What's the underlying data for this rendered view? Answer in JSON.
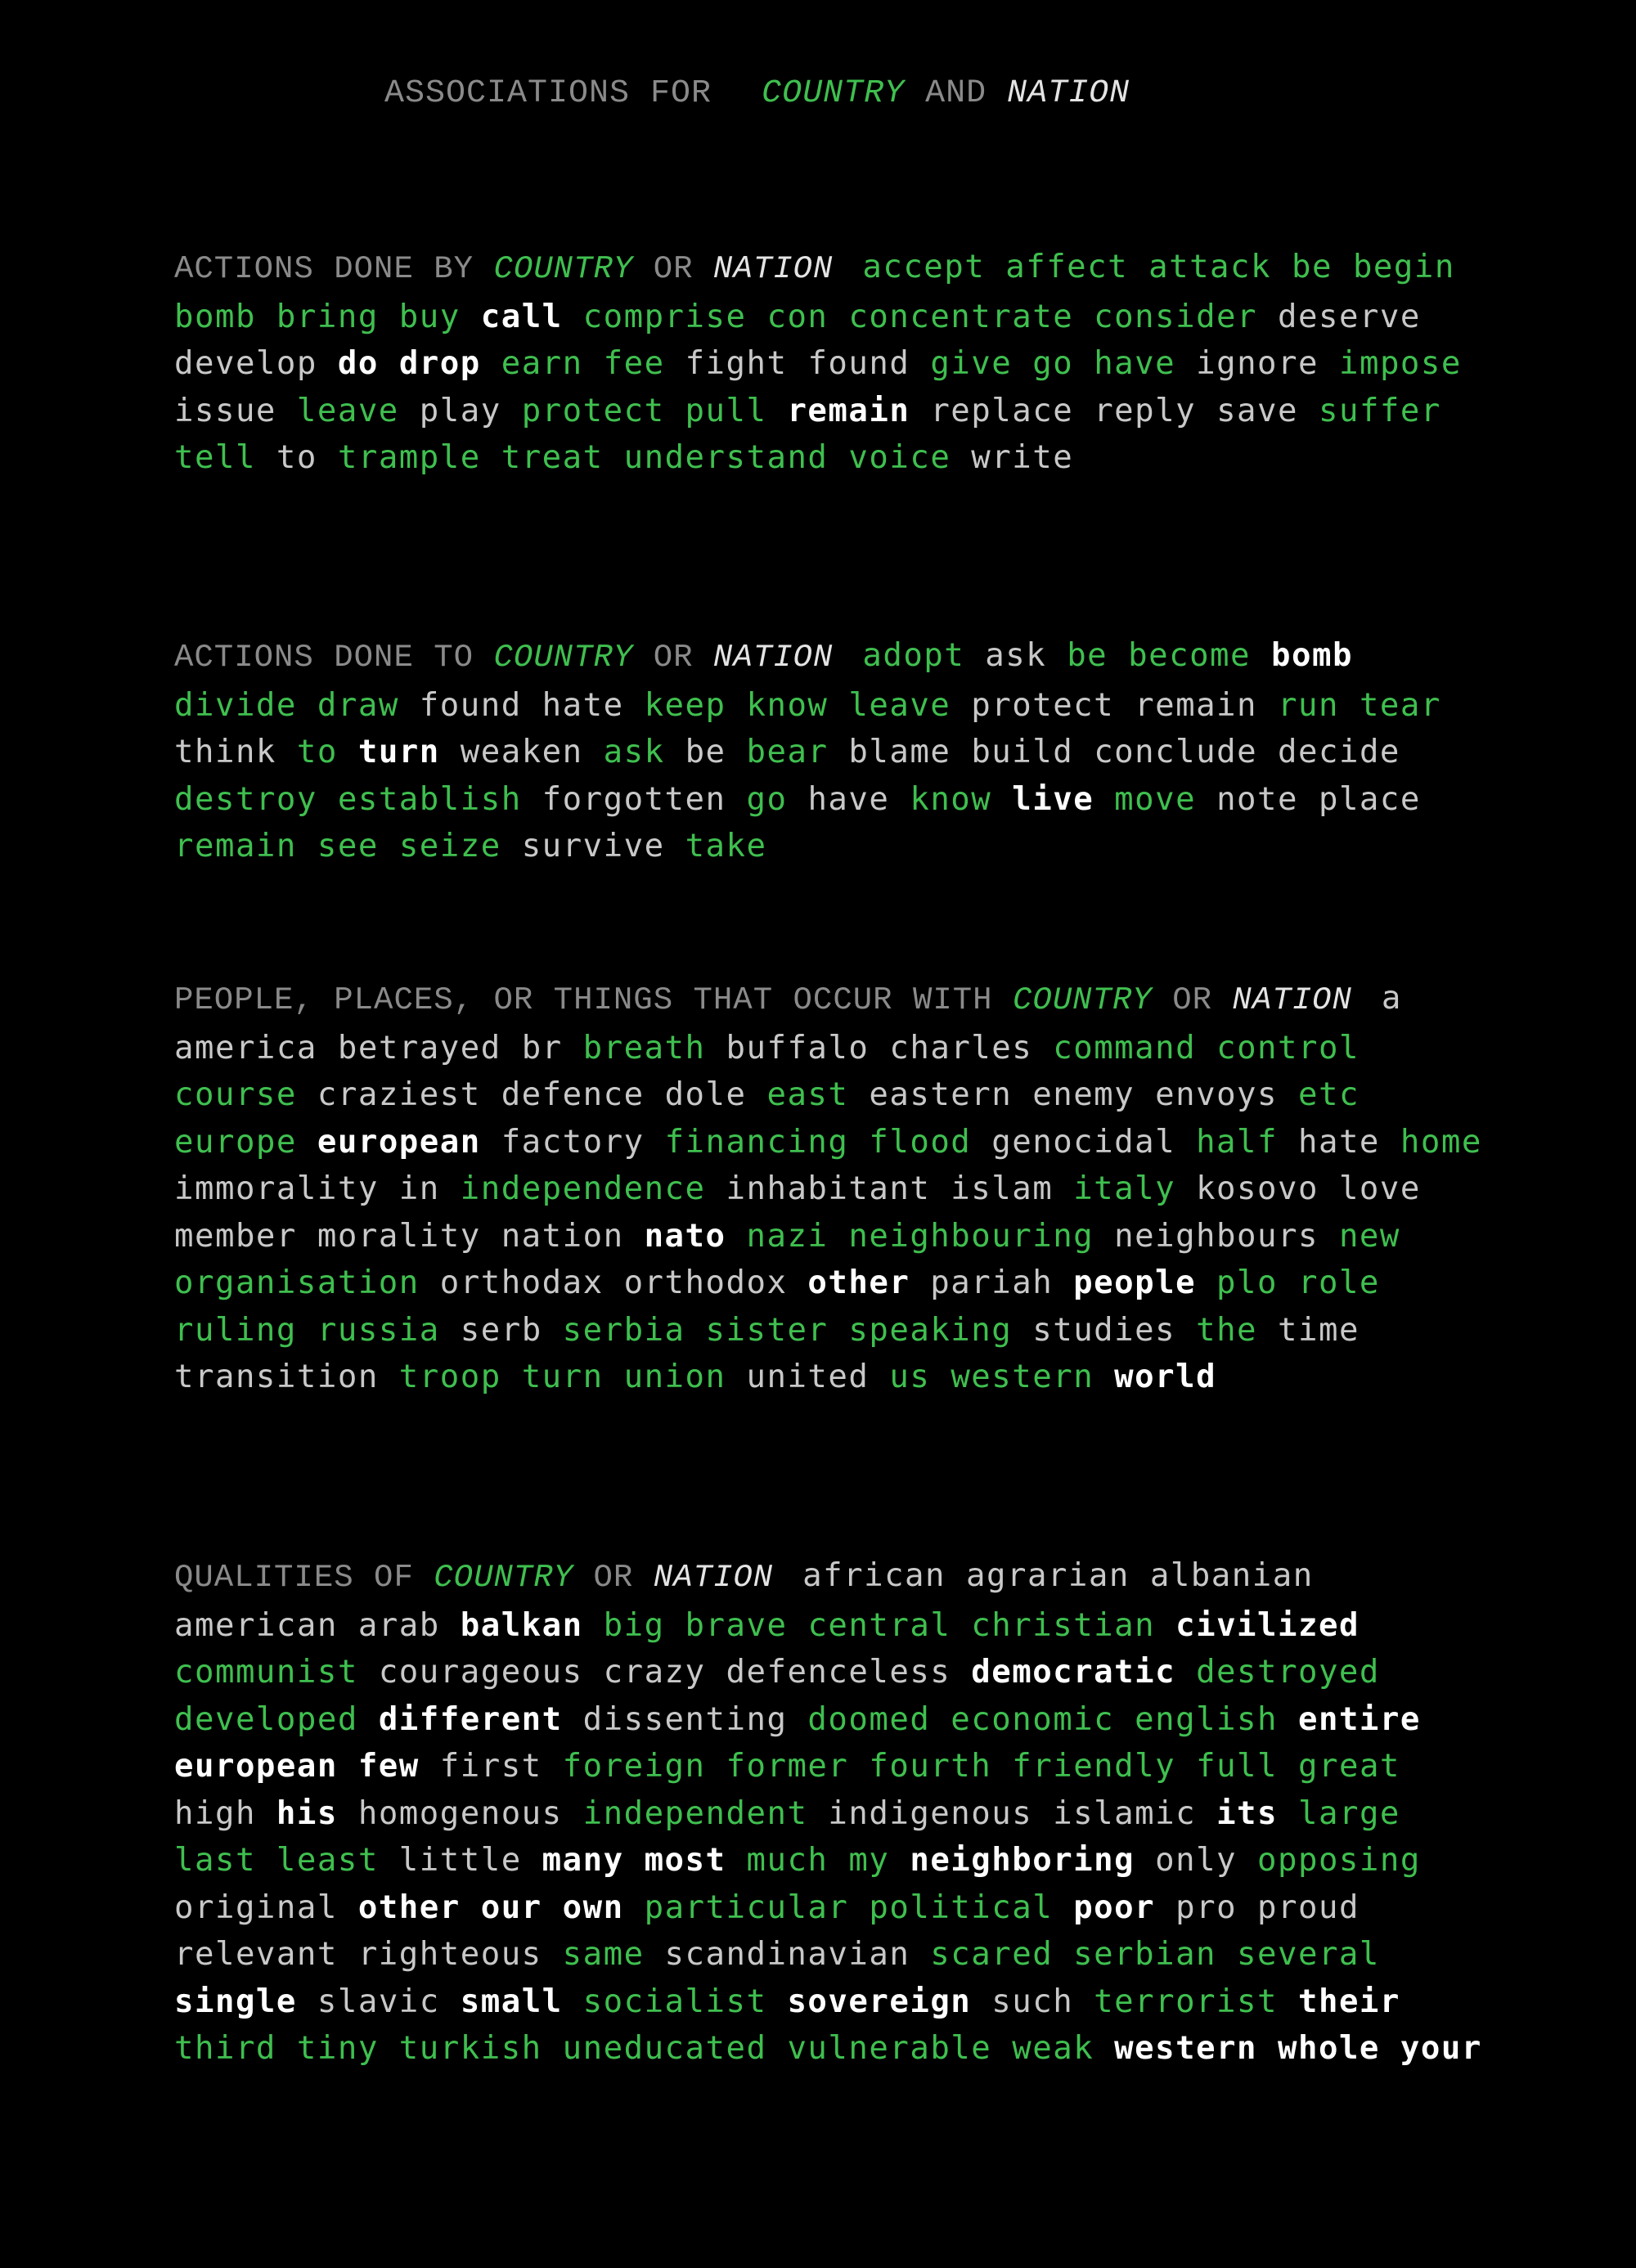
{
  "colors": {
    "background": "#000000",
    "heading": "#8a8a8a",
    "green": "#3fbf4f",
    "white": "#ffffff",
    "gray": "#c8c8c8",
    "nation": "#e4e4e4"
  },
  "title": {
    "prefix": "ASSOCIATIONS FOR",
    "term1": "COUNTRY",
    "joiner": "AND",
    "term2": "NATION"
  },
  "sections": [
    {
      "heading_prefix": "ACTIONS DONE BY",
      "term1": "COUNTRY",
      "joiner": "OR",
      "term2": "NATION",
      "words": [
        [
          "accept",
          "green"
        ],
        [
          "affect",
          "green"
        ],
        [
          "attack",
          "green"
        ],
        [
          "be",
          "green"
        ],
        [
          "begin",
          "green"
        ],
        [
          "bomb",
          "green"
        ],
        [
          "bring",
          "green"
        ],
        [
          "buy",
          "green"
        ],
        [
          "call",
          "white"
        ],
        [
          "comprise",
          "green"
        ],
        [
          "con",
          "green"
        ],
        [
          "concentrate",
          "green"
        ],
        [
          "consider",
          "green"
        ],
        [
          "deserve",
          "gray"
        ],
        [
          "develop",
          "gray"
        ],
        [
          "do",
          "white"
        ],
        [
          "drop",
          "white"
        ],
        [
          "earn",
          "green"
        ],
        [
          "fee",
          "green"
        ],
        [
          "fight",
          "gray"
        ],
        [
          "found",
          "gray"
        ],
        [
          "give",
          "green"
        ],
        [
          "go",
          "green"
        ],
        [
          "have",
          "green"
        ],
        [
          "ignore",
          "gray"
        ],
        [
          "impose",
          "green"
        ],
        [
          "issue",
          "gray"
        ],
        [
          "leave",
          "green"
        ],
        [
          "play",
          "gray"
        ],
        [
          "protect",
          "green"
        ],
        [
          "pull",
          "green"
        ],
        [
          "remain",
          "white"
        ],
        [
          "replace",
          "gray"
        ],
        [
          "reply",
          "gray"
        ],
        [
          "save",
          "gray"
        ],
        [
          "suffer",
          "green"
        ],
        [
          "tell",
          "green"
        ],
        [
          "to",
          "gray"
        ],
        [
          "trample",
          "green"
        ],
        [
          "treat",
          "green"
        ],
        [
          "understand",
          "green"
        ],
        [
          "voice",
          "green"
        ],
        [
          "write",
          "gray"
        ]
      ]
    },
    {
      "heading_prefix": "ACTIONS DONE TO",
      "term1": "COUNTRY",
      "joiner": "OR",
      "term2": "NATION",
      "words": [
        [
          "adopt",
          "green"
        ],
        [
          "ask",
          "gray"
        ],
        [
          "be",
          "green"
        ],
        [
          "become",
          "green"
        ],
        [
          "bomb",
          "white"
        ],
        [
          "divide",
          "green"
        ],
        [
          "draw",
          "green"
        ],
        [
          "found",
          "gray"
        ],
        [
          "hate",
          "gray"
        ],
        [
          "keep",
          "green"
        ],
        [
          "know",
          "green"
        ],
        [
          "leave",
          "green"
        ],
        [
          "protect",
          "gray"
        ],
        [
          "remain",
          "gray"
        ],
        [
          "run",
          "green"
        ],
        [
          "tear",
          "green"
        ],
        [
          "think",
          "gray"
        ],
        [
          "to",
          "green"
        ],
        [
          "turn",
          "white"
        ],
        [
          "weaken",
          "gray"
        ],
        [
          "ask",
          "green"
        ],
        [
          "be",
          "gray"
        ],
        [
          "bear",
          "green"
        ],
        [
          "blame",
          "gray"
        ],
        [
          "build",
          "gray"
        ],
        [
          "conclude",
          "gray"
        ],
        [
          "decide",
          "gray"
        ],
        [
          "destroy",
          "green"
        ],
        [
          "establish",
          "green"
        ],
        [
          "forgotten",
          "gray"
        ],
        [
          "go",
          "green"
        ],
        [
          "have",
          "gray"
        ],
        [
          "know",
          "green"
        ],
        [
          "live",
          "white"
        ],
        [
          "move",
          "green"
        ],
        [
          "note",
          "gray"
        ],
        [
          "place",
          "gray"
        ],
        [
          "remain",
          "green"
        ],
        [
          "see",
          "green"
        ],
        [
          "seize",
          "green"
        ],
        [
          "survive",
          "gray"
        ],
        [
          "take",
          "green"
        ]
      ]
    },
    {
      "heading_prefix": "PEOPLE, PLACES, OR THINGS THAT OCCUR WITH",
      "term1": "COUNTRY",
      "joiner": "OR",
      "term2": "NATION",
      "words": [
        [
          "a",
          "gray"
        ],
        [
          "america",
          "gray"
        ],
        [
          "betrayed",
          "gray"
        ],
        [
          "br",
          "gray"
        ],
        [
          "breath",
          "green"
        ],
        [
          "buffalo",
          "gray"
        ],
        [
          "charles",
          "gray"
        ],
        [
          "command",
          "green"
        ],
        [
          "control",
          "green"
        ],
        [
          "course",
          "green"
        ],
        [
          "craziest",
          "gray"
        ],
        [
          "defence",
          "gray"
        ],
        [
          "dole",
          "gray"
        ],
        [
          "east",
          "green"
        ],
        [
          "eastern",
          "gray"
        ],
        [
          "enemy",
          "gray"
        ],
        [
          "envoys",
          "gray"
        ],
        [
          "etc",
          "green"
        ],
        [
          "europe",
          "green"
        ],
        [
          "european",
          "white"
        ],
        [
          "factory",
          "gray"
        ],
        [
          "financing",
          "green"
        ],
        [
          "flood",
          "green"
        ],
        [
          "genocidal",
          "gray"
        ],
        [
          "half",
          "green"
        ],
        [
          "hate",
          "gray"
        ],
        [
          "home",
          "green"
        ],
        [
          "immorality",
          "gray"
        ],
        [
          "in",
          "gray"
        ],
        [
          "independence",
          "green"
        ],
        [
          "inhabitant",
          "gray"
        ],
        [
          "islam",
          "gray"
        ],
        [
          "italy",
          "green"
        ],
        [
          "kosovo",
          "gray"
        ],
        [
          "love",
          "gray"
        ],
        [
          "member",
          "gray"
        ],
        [
          "morality",
          "gray"
        ],
        [
          "nation",
          "gray"
        ],
        [
          "nato",
          "white"
        ],
        [
          "nazi",
          "green"
        ],
        [
          "neighbouring",
          "green"
        ],
        [
          "neighbours",
          "gray"
        ],
        [
          "new",
          "green"
        ],
        [
          "organisation",
          "green"
        ],
        [
          "orthodax",
          "gray"
        ],
        [
          "orthodox",
          "gray"
        ],
        [
          "other",
          "white"
        ],
        [
          "pariah",
          "gray"
        ],
        [
          "people",
          "white"
        ],
        [
          "plo",
          "green"
        ],
        [
          "role",
          "green"
        ],
        [
          "ruling",
          "green"
        ],
        [
          "russia",
          "green"
        ],
        [
          "serb",
          "gray"
        ],
        [
          "serbia",
          "green"
        ],
        [
          "sister",
          "green"
        ],
        [
          "speaking",
          "green"
        ],
        [
          "studies",
          "gray"
        ],
        [
          "the",
          "green"
        ],
        [
          "time",
          "gray"
        ],
        [
          "transition",
          "gray"
        ],
        [
          "troop",
          "green"
        ],
        [
          "turn",
          "green"
        ],
        [
          "union",
          "green"
        ],
        [
          "united",
          "gray"
        ],
        [
          "us",
          "green"
        ],
        [
          "western",
          "green"
        ],
        [
          "world",
          "white"
        ]
      ]
    },
    {
      "heading_prefix": "QUALITIES OF",
      "term1": "COUNTRY",
      "joiner": "OR",
      "term2": "NATION",
      "words": [
        [
          "african",
          "gray"
        ],
        [
          "agrarian",
          "gray"
        ],
        [
          "albanian",
          "gray"
        ],
        [
          "american",
          "gray"
        ],
        [
          "arab",
          "gray"
        ],
        [
          "balkan",
          "white"
        ],
        [
          "big",
          "green"
        ],
        [
          "brave",
          "green"
        ],
        [
          "central",
          "green"
        ],
        [
          "christian",
          "green"
        ],
        [
          "civilized",
          "white"
        ],
        [
          "communist",
          "green"
        ],
        [
          "courageous",
          "gray"
        ],
        [
          "crazy",
          "gray"
        ],
        [
          "defenceless",
          "gray"
        ],
        [
          "democratic",
          "white"
        ],
        [
          "destroyed",
          "green"
        ],
        [
          "developed",
          "green"
        ],
        [
          "different",
          "white"
        ],
        [
          "dissenting",
          "gray"
        ],
        [
          "doomed",
          "green"
        ],
        [
          "economic",
          "green"
        ],
        [
          "english",
          "green"
        ],
        [
          "entire",
          "white"
        ],
        [
          "european",
          "white"
        ],
        [
          "few",
          "white"
        ],
        [
          "first",
          "gray"
        ],
        [
          "foreign",
          "green"
        ],
        [
          "former",
          "green"
        ],
        [
          "fourth",
          "green"
        ],
        [
          "friendly",
          "green"
        ],
        [
          "full",
          "green"
        ],
        [
          "great",
          "green"
        ],
        [
          "high",
          "gray"
        ],
        [
          "his",
          "white"
        ],
        [
          "homogenous",
          "gray"
        ],
        [
          "independent",
          "green"
        ],
        [
          "indigenous",
          "gray"
        ],
        [
          "islamic",
          "gray"
        ],
        [
          "its",
          "white"
        ],
        [
          "large",
          "green"
        ],
        [
          "last",
          "green"
        ],
        [
          "least",
          "green"
        ],
        [
          "little",
          "gray"
        ],
        [
          "many",
          "white"
        ],
        [
          "most",
          "white"
        ],
        [
          "much",
          "green"
        ],
        [
          "my",
          "green"
        ],
        [
          "neighboring",
          "white"
        ],
        [
          "only",
          "gray"
        ],
        [
          "opposing",
          "green"
        ],
        [
          "original",
          "gray"
        ],
        [
          "other",
          "white"
        ],
        [
          "our",
          "white"
        ],
        [
          "own",
          "white"
        ],
        [
          "particular",
          "green"
        ],
        [
          "political",
          "green"
        ],
        [
          "poor",
          "white"
        ],
        [
          "pro",
          "gray"
        ],
        [
          "proud",
          "gray"
        ],
        [
          "relevant",
          "gray"
        ],
        [
          "righteous",
          "gray"
        ],
        [
          "same",
          "green"
        ],
        [
          "scandinavian",
          "gray"
        ],
        [
          "scared",
          "green"
        ],
        [
          "serbian",
          "green"
        ],
        [
          "several",
          "green"
        ],
        [
          "single",
          "white"
        ],
        [
          "slavic",
          "gray"
        ],
        [
          "small",
          "white"
        ],
        [
          "socialist",
          "green"
        ],
        [
          "sovereign",
          "white"
        ],
        [
          "such",
          "gray"
        ],
        [
          "terrorist",
          "green"
        ],
        [
          "their",
          "white"
        ],
        [
          "third",
          "green"
        ],
        [
          "tiny",
          "green"
        ],
        [
          "turkish",
          "green"
        ],
        [
          "uneducated",
          "green"
        ],
        [
          "vulnerable",
          "green"
        ],
        [
          "weak",
          "green"
        ],
        [
          "western",
          "white"
        ],
        [
          "whole",
          "white"
        ],
        [
          "your",
          "white"
        ]
      ]
    }
  ]
}
